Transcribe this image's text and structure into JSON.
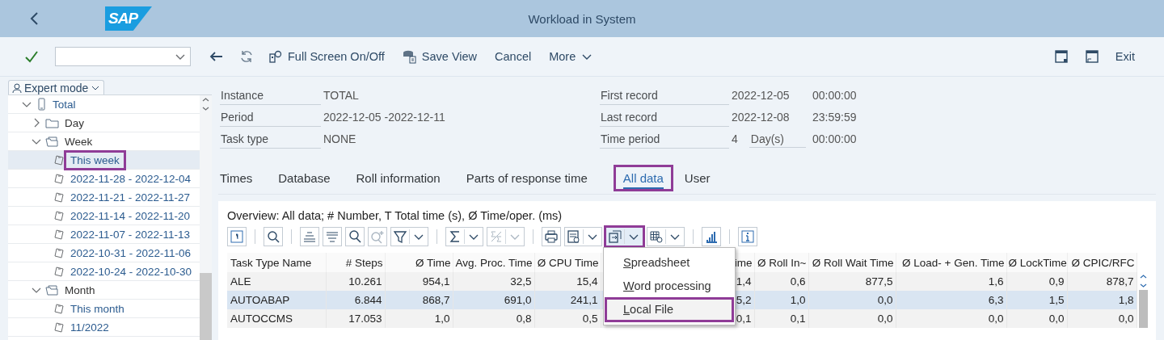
{
  "shell": {
    "logo": "SAP",
    "title": "Workload in System"
  },
  "toolbar": {
    "left": [
      {
        "kind": "back"
      },
      {
        "kind": "refresh"
      },
      {
        "kind": "fullscreen",
        "label": "Full Screen On/Off"
      },
      {
        "kind": "save_view",
        "label": "Save View"
      },
      {
        "kind": "text",
        "label": "Cancel"
      },
      {
        "kind": "menu",
        "label": "More"
      }
    ],
    "right": [
      {
        "kind": "new_window"
      },
      {
        "kind": "restore_window"
      },
      {
        "kind": "text",
        "label": "Exit"
      }
    ]
  },
  "sidebar": {
    "mode_button": "Expert mode",
    "tree": [
      {
        "label": "Total",
        "kind": "root",
        "expanded": true,
        "selected": false,
        "highlighted": false,
        "children": [
          {
            "label": "Day",
            "kind": "folder",
            "expanded": false,
            "selected": false,
            "highlighted": false
          },
          {
            "label": "Week",
            "kind": "folder",
            "expanded": true,
            "selected": false,
            "highlighted": false,
            "children": [
              {
                "label": "This week",
                "kind": "leaf",
                "selected": true,
                "highlighted": true
              },
              {
                "label": "2022-11-28 - 2022-12-04",
                "kind": "leaf",
                "selected": false,
                "highlighted": false
              },
              {
                "label": "2022-11-21 - 2022-11-27",
                "kind": "leaf",
                "selected": false,
                "highlighted": false
              },
              {
                "label": "2022-11-14 - 2022-11-20",
                "kind": "leaf",
                "selected": false,
                "highlighted": false
              },
              {
                "label": "2022-11-07 - 2022-11-13",
                "kind": "leaf",
                "selected": false,
                "highlighted": false
              },
              {
                "label": "2022-10-31 - 2022-11-06",
                "kind": "leaf",
                "selected": false,
                "highlighted": false
              },
              {
                "label": "2022-10-24 - 2022-10-30",
                "kind": "leaf",
                "selected": false,
                "highlighted": false
              }
            ]
          },
          {
            "label": "Month",
            "kind": "folder",
            "expanded": true,
            "selected": false,
            "highlighted": false,
            "children": [
              {
                "label": "This month",
                "kind": "leaf",
                "selected": false,
                "highlighted": false
              },
              {
                "label": "11/2022",
                "kind": "leaf",
                "selected": false,
                "highlighted": false
              }
            ]
          }
        ]
      }
    ]
  },
  "info": {
    "left": [
      {
        "label": "Instance",
        "value": "TOTAL"
      },
      {
        "label": "Period",
        "value": "2022-12-05 -2022-12-11"
      },
      {
        "label": "Task type",
        "value": "NONE"
      }
    ],
    "right": [
      {
        "label": "First record",
        "value": "2022-12-05",
        "time": "00:00:00"
      },
      {
        "label": "Last record",
        "value": "2022-12-08",
        "time": "23:59:59"
      },
      {
        "label": "Time period",
        "value": "4",
        "unit": "Day(s)",
        "time": "00:00:00"
      }
    ]
  },
  "tabs": [
    {
      "label": "Times",
      "selected": false,
      "highlighted": false
    },
    {
      "label": "Database",
      "selected": false,
      "highlighted": false
    },
    {
      "label": "Roll information",
      "selected": false,
      "highlighted": false
    },
    {
      "label": "Parts of response time",
      "selected": false,
      "highlighted": false
    },
    {
      "label": "All data",
      "selected": true,
      "highlighted": true
    },
    {
      "label": "User",
      "selected": false,
      "highlighted": false
    }
  ],
  "alv": {
    "title": "Overview: All data; # Number, T Total time (s), Ø Time/oper. (ms)",
    "toolbar": [
      {
        "kind": "details",
        "dropdown": false,
        "disabled": false
      },
      {
        "kind": "separator"
      },
      {
        "kind": "zoom",
        "dropdown": false,
        "disabled": false
      },
      {
        "kind": "separator"
      },
      {
        "kind": "sort_asc",
        "dropdown": false,
        "disabled": false
      },
      {
        "kind": "sort_desc",
        "dropdown": false,
        "disabled": false
      },
      {
        "kind": "find",
        "dropdown": false,
        "disabled": false
      },
      {
        "kind": "find_next",
        "dropdown": false,
        "disabled": true
      },
      {
        "kind": "filter",
        "dropdown": true,
        "disabled": false
      },
      {
        "kind": "separator"
      },
      {
        "kind": "sum",
        "dropdown": true,
        "disabled": false
      },
      {
        "kind": "subtotal",
        "dropdown": true,
        "disabled": true
      },
      {
        "kind": "separator"
      },
      {
        "kind": "print",
        "dropdown": false,
        "disabled": false
      },
      {
        "kind": "view",
        "dropdown": true,
        "disabled": false
      },
      {
        "kind": "export",
        "dropdown": true,
        "disabled": false,
        "highlighted": true,
        "expanded": true,
        "menu": [
          {
            "label": "Spreadsheet",
            "highlighted": false
          },
          {
            "label": "Word processing",
            "highlighted": false
          },
          {
            "label": "Local File",
            "highlighted": true
          }
        ]
      },
      {
        "kind": "layout",
        "dropdown": true,
        "disabled": false
      },
      {
        "kind": "separator"
      },
      {
        "kind": "graphic",
        "dropdown": false,
        "disabled": false
      },
      {
        "kind": "separator"
      },
      {
        "kind": "info",
        "dropdown": false,
        "disabled": false
      }
    ],
    "columns": [
      "Task Type Name",
      "# Steps",
      "Ø Time",
      "Avg. Proc. Time",
      "Ø CPU Time",
      "ime",
      "Ø Roll In~",
      "Ø Roll Wait Time",
      "Ø Load- + Gen. Time",
      "Ø LockTime",
      "Ø CPIC/RFC"
    ],
    "rows": [
      {
        "selected": false,
        "cells": [
          "ALE",
          "10.261",
          "954,1",
          "32,5",
          "15,4",
          "1,4",
          "0,6",
          "877,5",
          "1,6",
          "0,9",
          "878,7"
        ]
      },
      {
        "selected": true,
        "cells": [
          "AUTOABAP",
          "6.844",
          "868,7",
          "691,0",
          "241,1",
          "5,2",
          "1,0",
          "0,0",
          "6,3",
          "1,5",
          "1,8"
        ]
      },
      {
        "selected": false,
        "cells": [
          "AUTOCCMS",
          "17.053",
          "1,0",
          "0,8",
          "0,5",
          "0,1",
          "0,1",
          "0,0",
          "0,0",
          "0,0",
          "0,0"
        ]
      }
    ]
  }
}
